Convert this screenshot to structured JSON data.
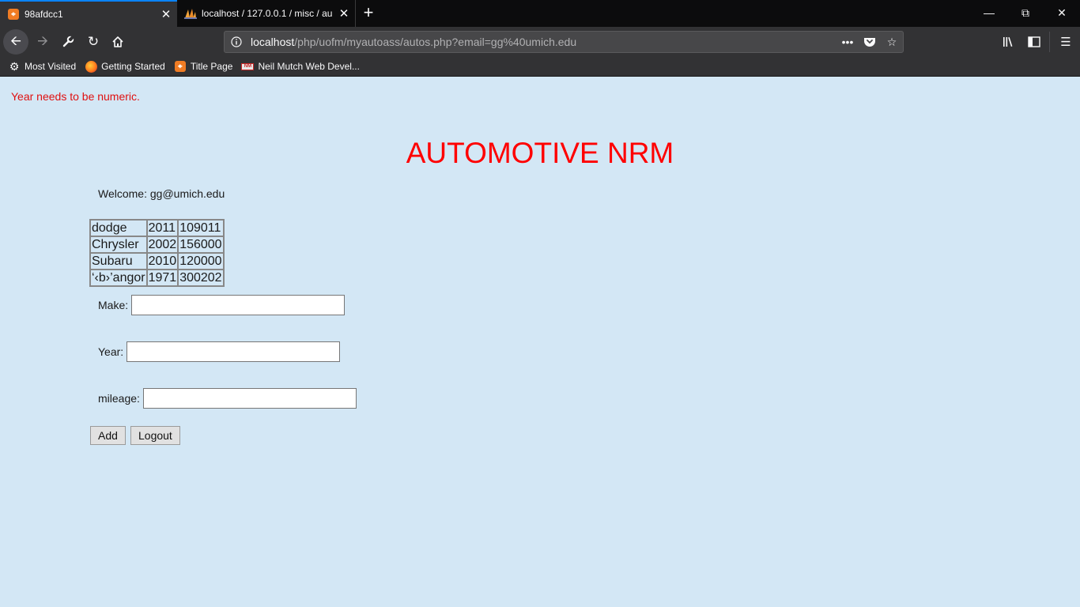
{
  "browser": {
    "tabs": [
      {
        "title": "98afdcc1",
        "icon": "xampp-icon",
        "active": true
      },
      {
        "title": "localhost / 127.0.0.1 / misc / au",
        "icon": "phpmyadmin-icon",
        "active": false
      }
    ],
    "url_host": "localhost",
    "url_path": "/php/uofm/myautoass/autos.php?email=gg%40umich.edu",
    "bookmarks": [
      {
        "label": "Most Visited",
        "icon": "gear-icon"
      },
      {
        "label": "Getting Started",
        "icon": "firefox-icon"
      },
      {
        "label": "Title Page",
        "icon": "xampp-icon"
      },
      {
        "label": "Neil Mutch Web Devel...",
        "icon": "nm-icon"
      }
    ]
  },
  "page": {
    "error_message": "Year needs to be numeric.",
    "heading": "AUTOMOTIVE NRM",
    "welcome": "Welcome: gg@umich.edu",
    "table": [
      [
        "dodge",
        "2011",
        "109011"
      ],
      [
        "Chrysler",
        "2002",
        "156000"
      ],
      [
        "Subaru",
        "2010",
        "120000"
      ],
      [
        "‘‹b›’angor",
        "1971",
        "300202"
      ]
    ],
    "form": {
      "make_label": "Make:",
      "year_label": "Year:",
      "mileage_label": "mileage:",
      "make_value": "",
      "year_value": "",
      "mileage_value": "",
      "add_label": "Add",
      "logout_label": "Logout"
    }
  },
  "colors": {
    "page_background": "#d3e7f5",
    "heading": "#ff0000",
    "error": "#e01010",
    "tab_accent": "#0a84ff"
  }
}
